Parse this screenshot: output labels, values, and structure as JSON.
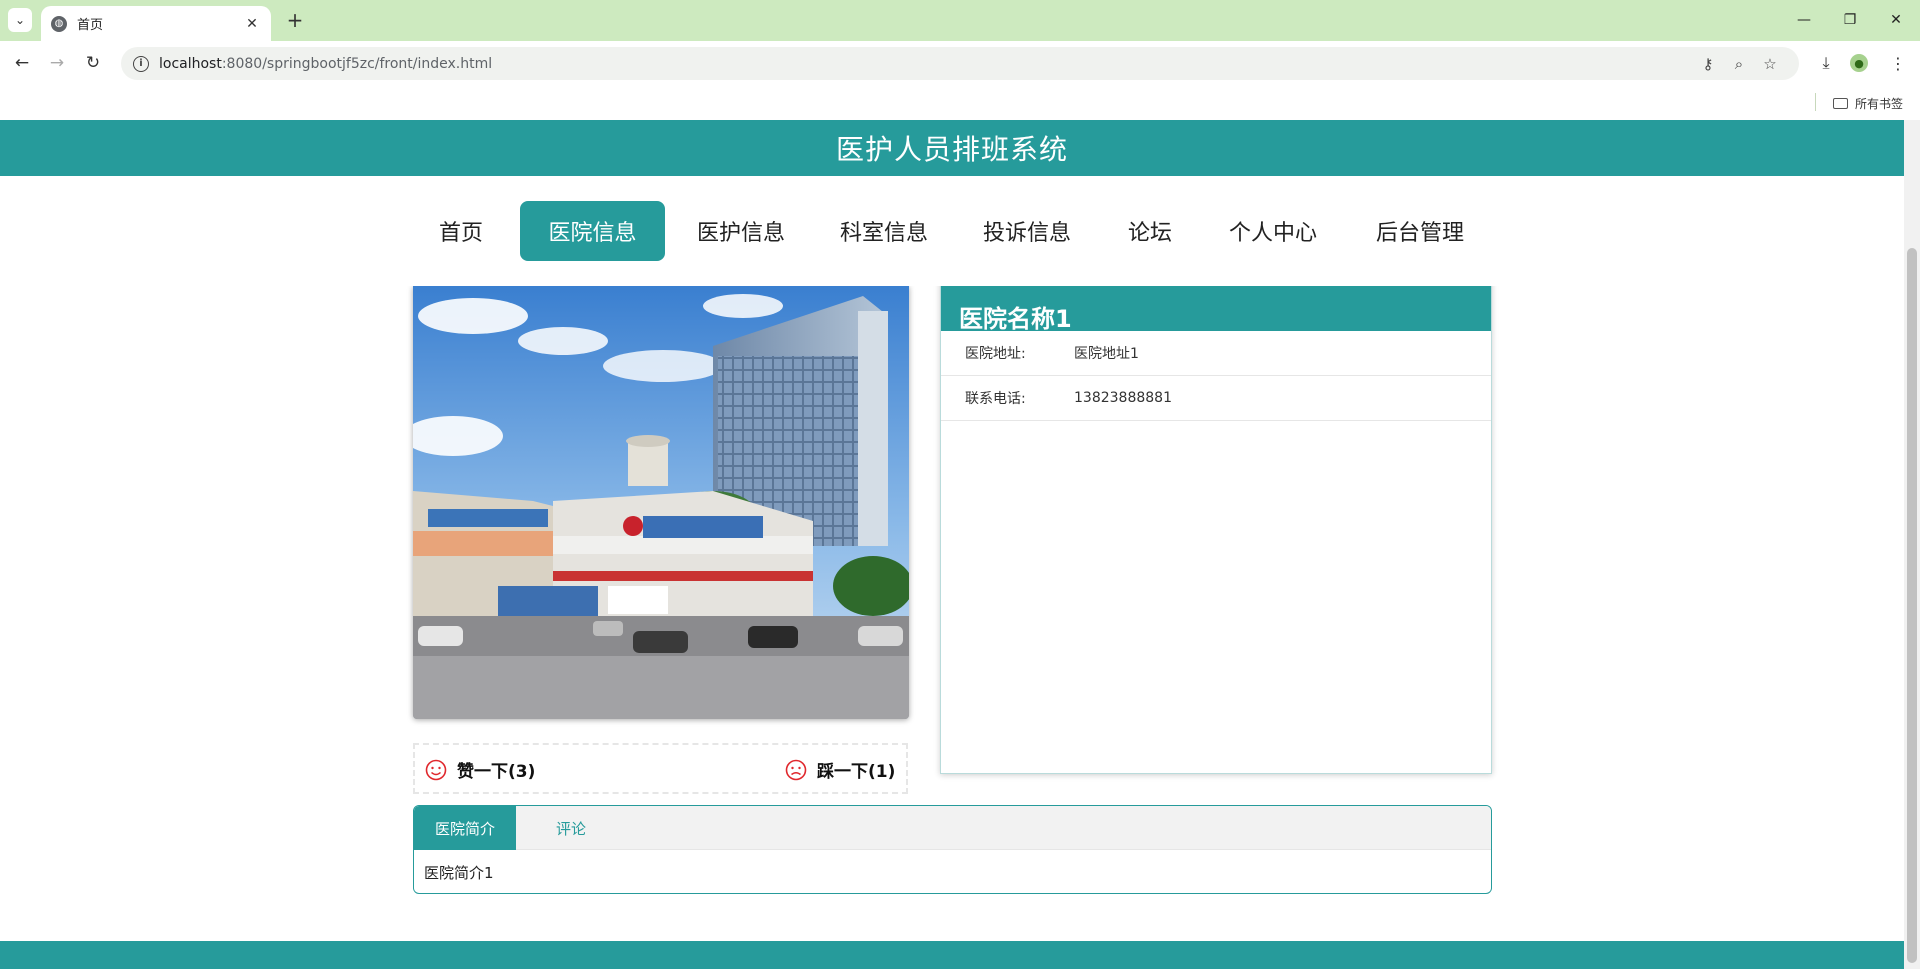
{
  "browser": {
    "tab_title": "首页",
    "url_host": "localhost",
    "url_rest": ":8080/springbootjf5zc/front/index.html",
    "bookmarks_label": "所有书签"
  },
  "site": {
    "title": "医护人员排班系统",
    "accent_color": "#269b9b"
  },
  "nav": {
    "items": [
      {
        "label": "首页"
      },
      {
        "label": "医院信息"
      },
      {
        "label": "医护信息"
      },
      {
        "label": "科室信息"
      },
      {
        "label": "投诉信息"
      },
      {
        "label": "论坛"
      },
      {
        "label": "个人中心"
      },
      {
        "label": "后台管理"
      }
    ],
    "active_index": 1
  },
  "hospital": {
    "name": "医院名称1",
    "fields": [
      {
        "key": "医院地址:",
        "value": "医院地址1"
      },
      {
        "key": "联系电话:",
        "value": "13823888881"
      }
    ],
    "like_label": "赞一下(3)",
    "dislike_label": "踩一下(1)"
  },
  "detail_tabs": {
    "tabs": [
      "医院简介",
      "评论"
    ],
    "active": 0,
    "content": "医院简介1"
  }
}
